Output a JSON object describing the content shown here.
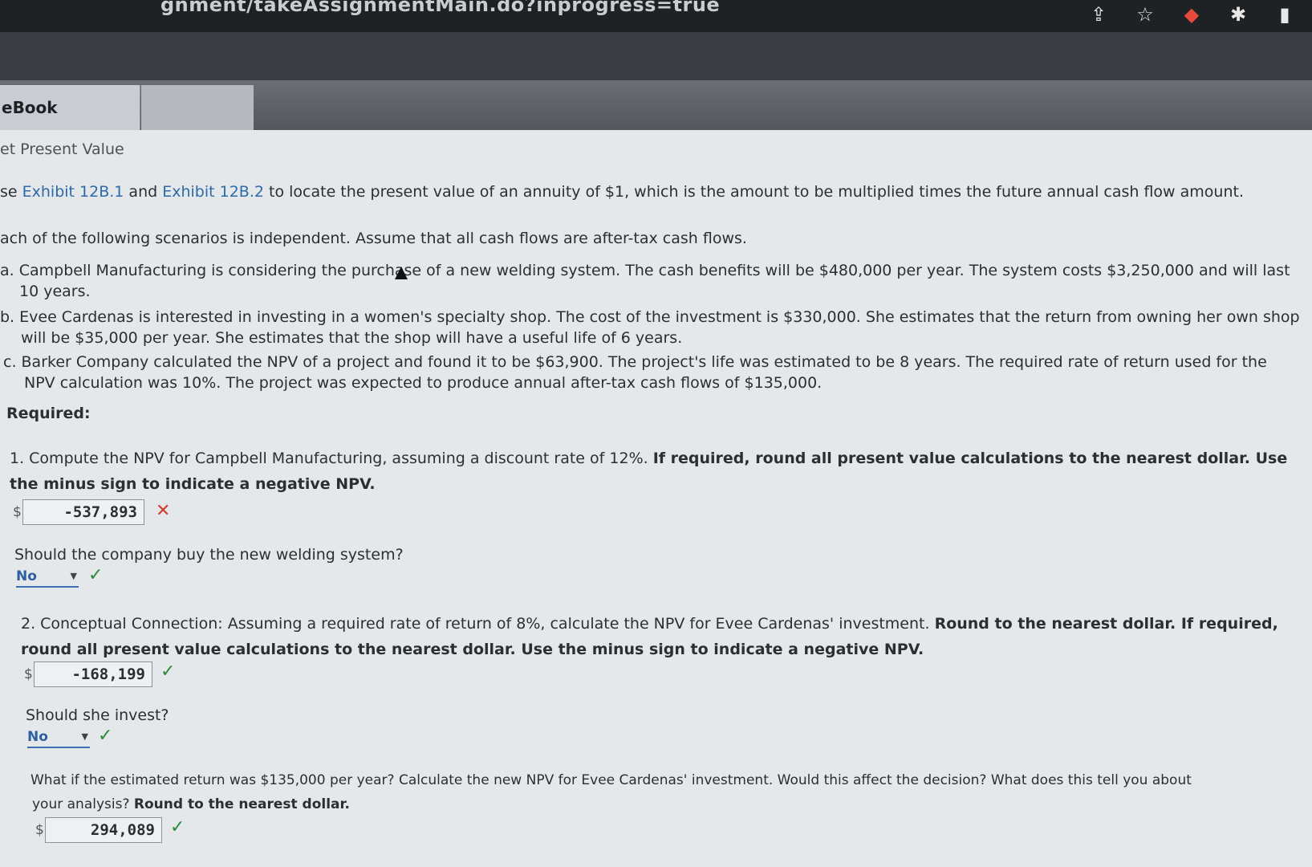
{
  "browser": {
    "url_fragment": "gnment/takeAssignmentMain.do?inprogress=true",
    "icons": [
      "share-icon",
      "star-icon",
      "extension-red-icon",
      "puzzle-icon",
      "sidebar-icon"
    ]
  },
  "tabs": {
    "ebook": "eBook"
  },
  "page": {
    "title": "et Present Value",
    "intro_prefix": "se ",
    "exhibit1": "Exhibit 12B.1",
    "and": " and ",
    "exhibit2": "Exhibit 12B.2",
    "intro_suffix": " to locate the present value of an annuity of $1, which is the amount to be multiplied times the future annual cash flow amount.",
    "scenarios_intro": "ach of the following scenarios is independent. Assume that all cash flows are after-tax cash flows.",
    "a_line1": "a. Campbell Manufacturing is considering the purchase of a new welding system. The cash benefits will be $480,000 per year. The system costs $3,250,000 and will last",
    "a_line2": "10 years.",
    "b_line1": "b. Evee Cardenas is interested in investing in a women's specialty shop. The cost of the investment is $330,000. She estimates that the return from owning her own shop",
    "b_line2": "will be $35,000 per year. She estimates that the shop will have a useful life of 6 years.",
    "c_line1": "c. Barker Company calculated the NPV of a project and found it to be $63,900. The project's life was estimated to be 8 years. The required rate of return used for the",
    "c_line2": "NPV calculation was 10%. The project was expected to produce annual after-tax cash flows of $135,000.",
    "required": "Required:"
  },
  "q1": {
    "text_normal": "1. Compute the NPV for Campbell Manufacturing, assuming a discount rate of 12%. ",
    "text_bold1": "If required, round all present value calculations to the nearest dollar. Use",
    "text_bold2": "the minus sign to indicate a negative NPV.",
    "currency": "$",
    "answer": "-537,893",
    "status": "✕",
    "sub_question": "Should the company buy the new welding system?",
    "select_value": "No",
    "select_status": "✓"
  },
  "q2": {
    "text_normal": "2. Conceptual Connection: Assuming a required rate of return of 8%, calculate the NPV for Evee Cardenas' investment. ",
    "text_bold1": "Round to the nearest dollar. If required,",
    "text_bold2": "round all present value calculations to the nearest dollar. Use the minus sign to indicate a negative NPV.",
    "currency": "$",
    "answer": "-168,199",
    "status": "✓",
    "sub_question": "Should she invest?",
    "select_value": "No",
    "select_status": "✓",
    "followup_normal": "What if the estimated return was $135,000 per year? Calculate the new NPV for Evee Cardenas' investment. Would this affect the decision? What does this tell you about",
    "followup_line2_normal": "your analysis? ",
    "followup_line2_bold": "Round to the nearest dollar.",
    "followup_currency": "$",
    "followup_answer": "294,089",
    "followup_status": "✓"
  }
}
